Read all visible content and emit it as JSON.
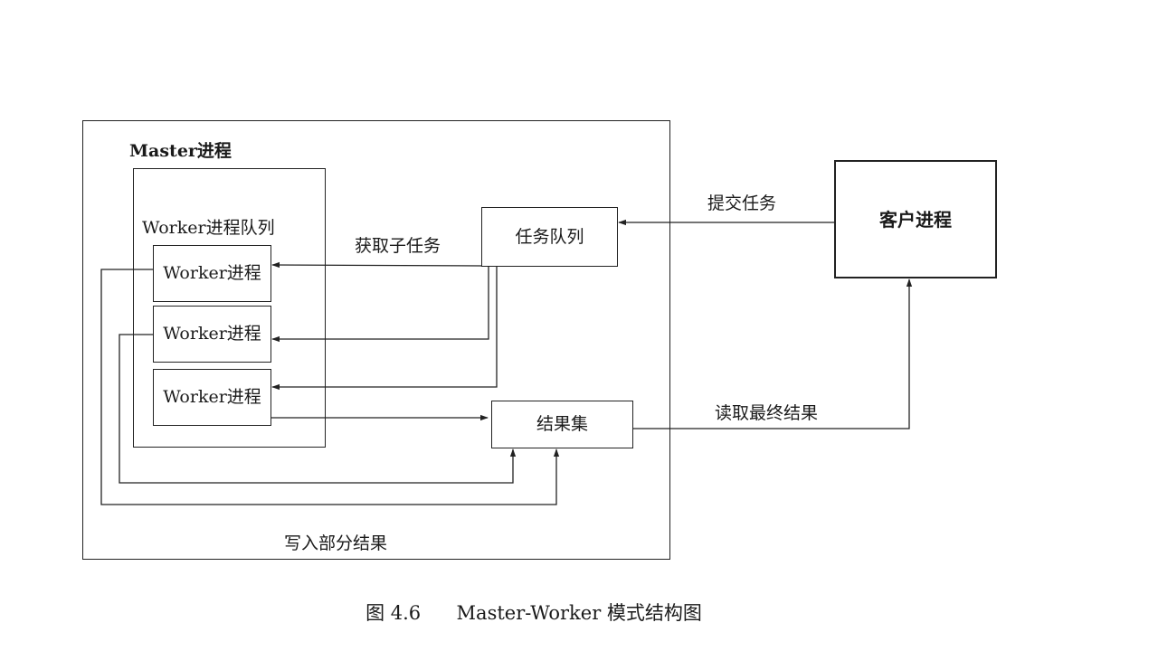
{
  "diagram": {
    "master_label": "Master进程",
    "worker_queue_label": "Worker进程队列",
    "workers": [
      {
        "label": "Worker进程"
      },
      {
        "label": "Worker进程"
      },
      {
        "label": "Worker进程"
      }
    ],
    "task_queue_label": "任务队列",
    "result_set_label": "结果集",
    "client_label": "客户进程",
    "edge_labels": {
      "submit_task": "提交任务",
      "fetch_subtask": "获取子任务",
      "read_final_result": "读取最终结果",
      "write_partial_result": "写入部分结果"
    }
  },
  "caption": {
    "figure_number": "图 4.6",
    "title": "Master-Worker 模式结构图"
  }
}
